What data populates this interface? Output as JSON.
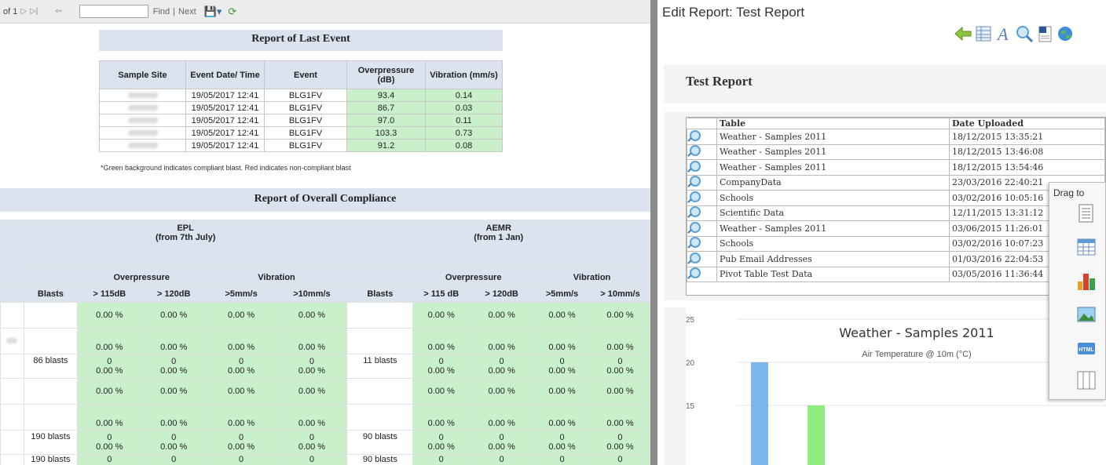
{
  "toolbar": {
    "page_of": "of 1",
    "find": "Find",
    "sep": "|",
    "next": "Next",
    "find_value": ""
  },
  "event_report": {
    "title": "Report of Last Event",
    "headers": [
      "Sample Site",
      "Event Date/ Time",
      "Event",
      "Overpressure (dB)",
      "Vibration (mm/s)"
    ],
    "rows": [
      {
        "datetime": "19/05/2017 12:41",
        "event": "BLG1FV",
        "overpressure": "93.4",
        "vibration": "0.14"
      },
      {
        "datetime": "19/05/2017 12:41",
        "event": "BLG1FV",
        "overpressure": "86.7",
        "vibration": "0.03"
      },
      {
        "datetime": "19/05/2017 12:41",
        "event": "BLG1FV",
        "overpressure": "97.0",
        "vibration": "0.11"
      },
      {
        "datetime": "19/05/2017 12:41",
        "event": "BLG1FV",
        "overpressure": "103.3",
        "vibration": "0.73"
      },
      {
        "datetime": "19/05/2017 12:41",
        "event": "BLG1FV",
        "overpressure": "91.2",
        "vibration": "0.08"
      }
    ],
    "note": "*Green background indicates compliant blast. Red indicates non-compliant blast"
  },
  "compliance": {
    "title": "Report of Overall Compliance",
    "epl": "EPL",
    "epl_sub": "(from 7th July)",
    "aemr": "AEMR",
    "aemr_sub": "(from 1 Jan)",
    "overpressure": "Overpressure",
    "vibration": "Vibration",
    "blasts": "Blasts",
    "col_115a": "> 115dB",
    "col_120": "> 120dB",
    "col_5": ">5mm/s",
    "col_10a": ">10mm/s",
    "col_115b": "> 115 dB",
    "col_10b": "> 10mm/s",
    "pct": "0.00 %",
    "zero": "0",
    "blasts_86": "86 blasts",
    "blasts_11": "11 blasts",
    "blasts_190": "190 blasts",
    "blasts_90": "90 blasts"
  },
  "editor": {
    "title": "Edit Report: Test Report",
    "report_name": "Test Report",
    "col_table": "Table",
    "col_date": "Date Uploaded",
    "files": [
      {
        "table": "Weather - Samples 2011",
        "date": "18/12/2015 13:35:21"
      },
      {
        "table": "Weather - Samples 2011",
        "date": "18/12/2015 13:46:08"
      },
      {
        "table": "Weather - Samples 2011",
        "date": "18/12/2015 13:54:46"
      },
      {
        "table": "CompanyData",
        "date": "23/03/2016 22:40:21"
      },
      {
        "table": "Schools",
        "date": "03/02/2016 10:05:16"
      },
      {
        "table": "Scientific Data",
        "date": "12/11/2015 13:31:12"
      },
      {
        "table": "Weather - Samples 2011",
        "date": "03/06/2015 11:26:01"
      },
      {
        "table": "Schools",
        "date": "03/02/2016 10:07:23"
      },
      {
        "table": "Pub Email Addresses",
        "date": "01/03/2016 22:04:53"
      },
      {
        "table": "Pivot Table Test Data",
        "date": "03/05/2016 11:36:44"
      }
    ],
    "drag_to": "Drag to",
    "icons": [
      "back-arrow-icon",
      "table-icon",
      "text-icon",
      "magnify-icon",
      "word-doc-icon",
      "globe-icon"
    ],
    "drag_icons": [
      "text-block-icon",
      "grid-icon",
      "bar-chart-icon",
      "image-icon",
      "html-icon",
      "columns-icon"
    ],
    "html_badge": "HTML"
  },
  "chart_data": {
    "type": "bar",
    "title": "Weather - Samples 2011",
    "subtitle": "Air Temperature @ 10m (°C)",
    "yticks": [
      "25",
      "20",
      "15"
    ],
    "ylim": [
      10,
      25
    ],
    "series": [
      {
        "values": [
          20,
          15
        ],
        "colors": [
          "#7cb5ec",
          "#90ed7d"
        ]
      }
    ]
  }
}
